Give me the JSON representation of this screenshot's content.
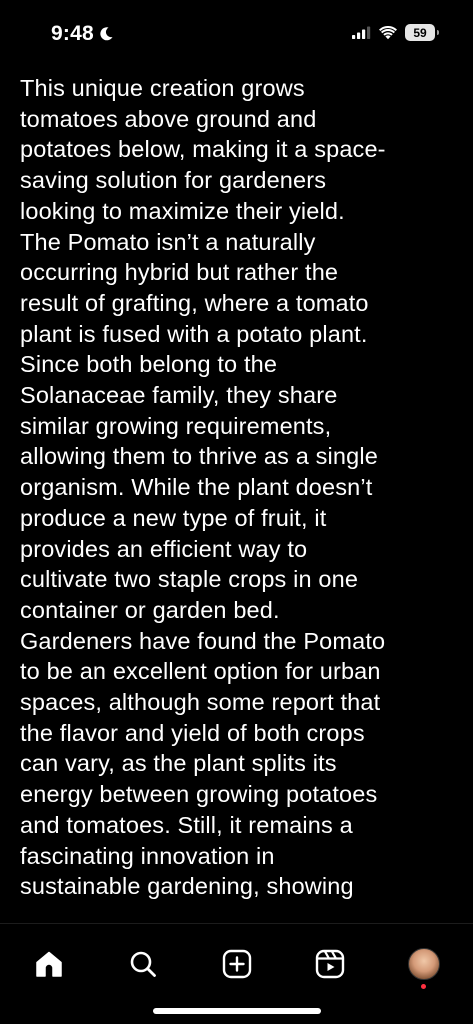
{
  "status_bar": {
    "time": "9:48",
    "battery_level": "59",
    "icons": [
      "moon-icon",
      "cellular-signal-icon",
      "wifi-icon",
      "battery-icon"
    ]
  },
  "article": {
    "paragraphs": [
      "This unique creation grows\ntomatoes above ground and\npotatoes below, making it a space-\nsaving solution for gardeners\nlooking to maximize their yield.",
      "The Pomato isn’t a naturally\noccurring hybrid but rather the\nresult of grafting, where a tomato\nplant is fused with a potato plant.\nSince both belong to the\nSolanaceae family, they share\nsimilar growing requirements,\nallowing them to thrive as a single\norganism. While the plant doesn’t\nproduce a new type of fruit, it\nprovides an efficient way to\ncultivate two staple crops in one\ncontainer or garden bed.",
      "Gardeners have found the Pomato\nto be an excellent option for urban\nspaces, although some report that\nthe flavor and yield of both crops\ncan vary, as the plant splits its\nenergy between growing potatoes\nand tomatoes. Still, it remains a\nfascinating innovation in\nsustainable gardening, showing"
    ]
  },
  "bottom_nav": {
    "items": [
      {
        "icon": "home-icon",
        "active": true
      },
      {
        "icon": "search-icon",
        "active": false
      },
      {
        "icon": "create-plus-icon",
        "active": false
      },
      {
        "icon": "reels-icon",
        "active": false
      },
      {
        "icon": "profile-avatar",
        "active": false
      }
    ],
    "notification_dot_color": "#ff3040"
  },
  "colors": {
    "background": "#000000",
    "text": "#ffffff"
  }
}
